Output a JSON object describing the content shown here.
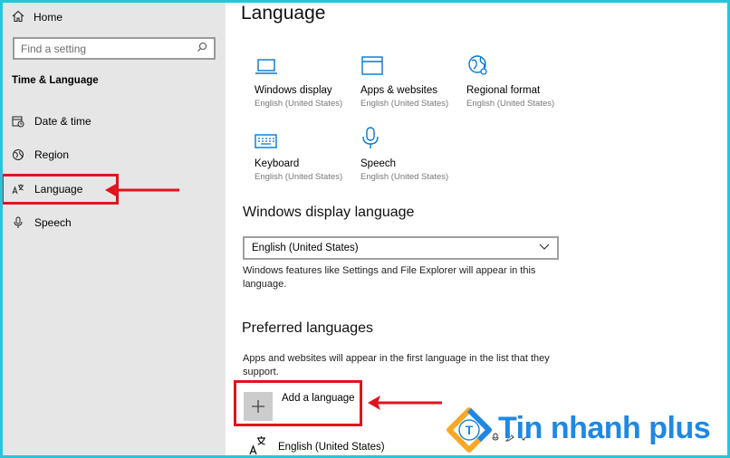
{
  "sidebar": {
    "home_label": "Home",
    "search_placeholder": "Find a setting",
    "section_title": "Time & Language",
    "items": [
      {
        "label": "Date & time",
        "icon": "calendar-clock-icon"
      },
      {
        "label": "Region",
        "icon": "globe-icon"
      },
      {
        "label": "Language",
        "icon": "language-icon"
      },
      {
        "label": "Speech",
        "icon": "microphone-icon"
      }
    ]
  },
  "main": {
    "title": "Language",
    "tiles": [
      {
        "name": "Windows display",
        "sub": "English (United States)",
        "icon": "laptop-icon"
      },
      {
        "name": "Apps & websites",
        "sub": "English (United States)",
        "icon": "window-icon"
      },
      {
        "name": "Regional format",
        "sub": "English (United States)",
        "icon": "globe-settings-icon"
      },
      {
        "name": "Keyboard",
        "sub": "English (United States)",
        "icon": "keyboard-icon"
      },
      {
        "name": "Speech",
        "sub": "English (United States)",
        "icon": "microphone-icon"
      }
    ],
    "display_language": {
      "heading": "Windows display language",
      "selected": "English (United States)",
      "description": "Windows features like Settings and File Explorer will appear in this language."
    },
    "preferred": {
      "heading": "Preferred languages",
      "description": "Apps and websites will appear in the first language in the list that they support.",
      "add_label": "Add a language",
      "languages": [
        "English (United States)"
      ]
    }
  },
  "logo": {
    "text": "Tin nhanh plus"
  },
  "colors": {
    "accent": "#0078d7",
    "highlight": "#e0141e",
    "frame": "#26c6da"
  }
}
